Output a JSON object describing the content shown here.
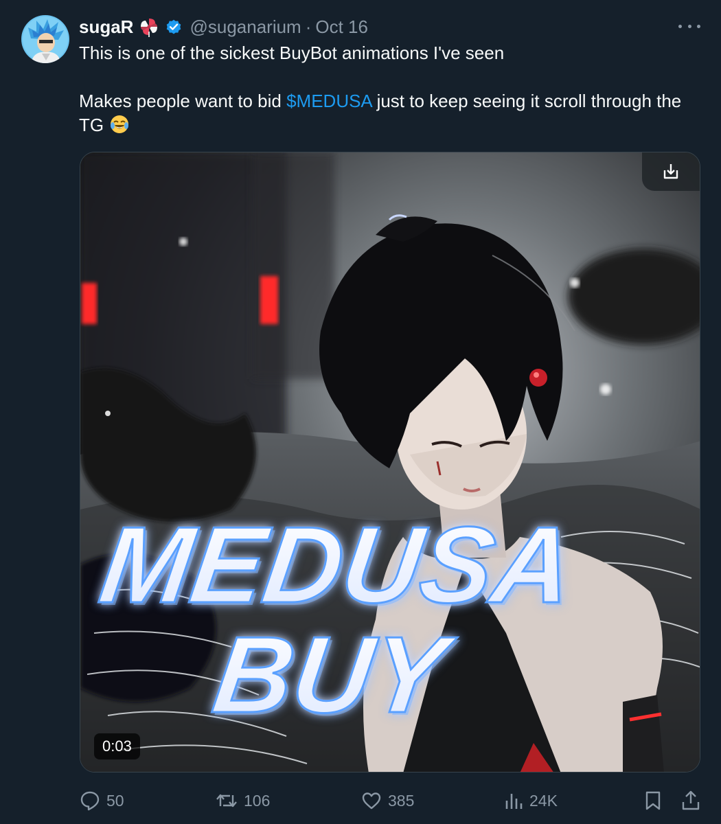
{
  "user": {
    "display_name": "sugaR",
    "handle": "@suganarium",
    "separator": "·",
    "date": "Oct 16"
  },
  "icons": {
    "avatar": "avatar-image",
    "name_emoji": "pinwheel-candy-icon",
    "verified": "verified-badge-icon",
    "more": "more-options-icon",
    "text_emoji": "laughing-crying-emoji",
    "download": "download-icon",
    "reply": "reply-icon",
    "repost": "repost-icon",
    "like": "heart-icon",
    "views": "views-icon",
    "bookmark": "bookmark-icon",
    "share": "share-icon"
  },
  "tweet": {
    "line1": "This is one of the sickest BuyBot animations I've seen",
    "line2_before": "Makes people want to bid ",
    "cashtag": "$MEDUSA",
    "line2_after": " just to keep seeing it scroll through the TG"
  },
  "media": {
    "overlay_word1": "MEDUSA",
    "overlay_word2": "BUY",
    "duration": "0:03"
  },
  "stats": {
    "replies": "50",
    "reposts": "106",
    "likes": "385",
    "views": "24K"
  },
  "colors": {
    "background": "#15202b",
    "text": "#f7f9f9",
    "muted": "#8b98a5",
    "link": "#1d9bf0",
    "verified": "#1d9bf0"
  }
}
